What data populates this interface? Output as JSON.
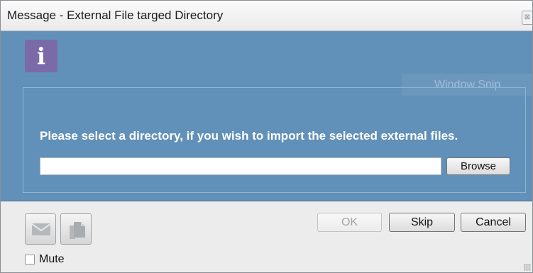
{
  "window": {
    "title": "Message - External File targed Directory",
    "close_glyph": "⊠"
  },
  "panel": {
    "info_icon": "i",
    "message": "Please select a directory, if you wish to import the selected external files.",
    "directory_value": "",
    "browse_label": "Browse",
    "overlay_text": "Window Snip"
  },
  "footer": {
    "email_icon": "envelope-icon",
    "copy_icon": "copy-icon",
    "ok_label": "OK",
    "skip_label": "Skip",
    "cancel_label": "Cancel",
    "mute_label": "Mute",
    "mute_checked": false
  },
  "colors": {
    "panel_blue": "#6190b8",
    "info_tile": "#7a6aa8",
    "footer_gray": "#ececec"
  }
}
